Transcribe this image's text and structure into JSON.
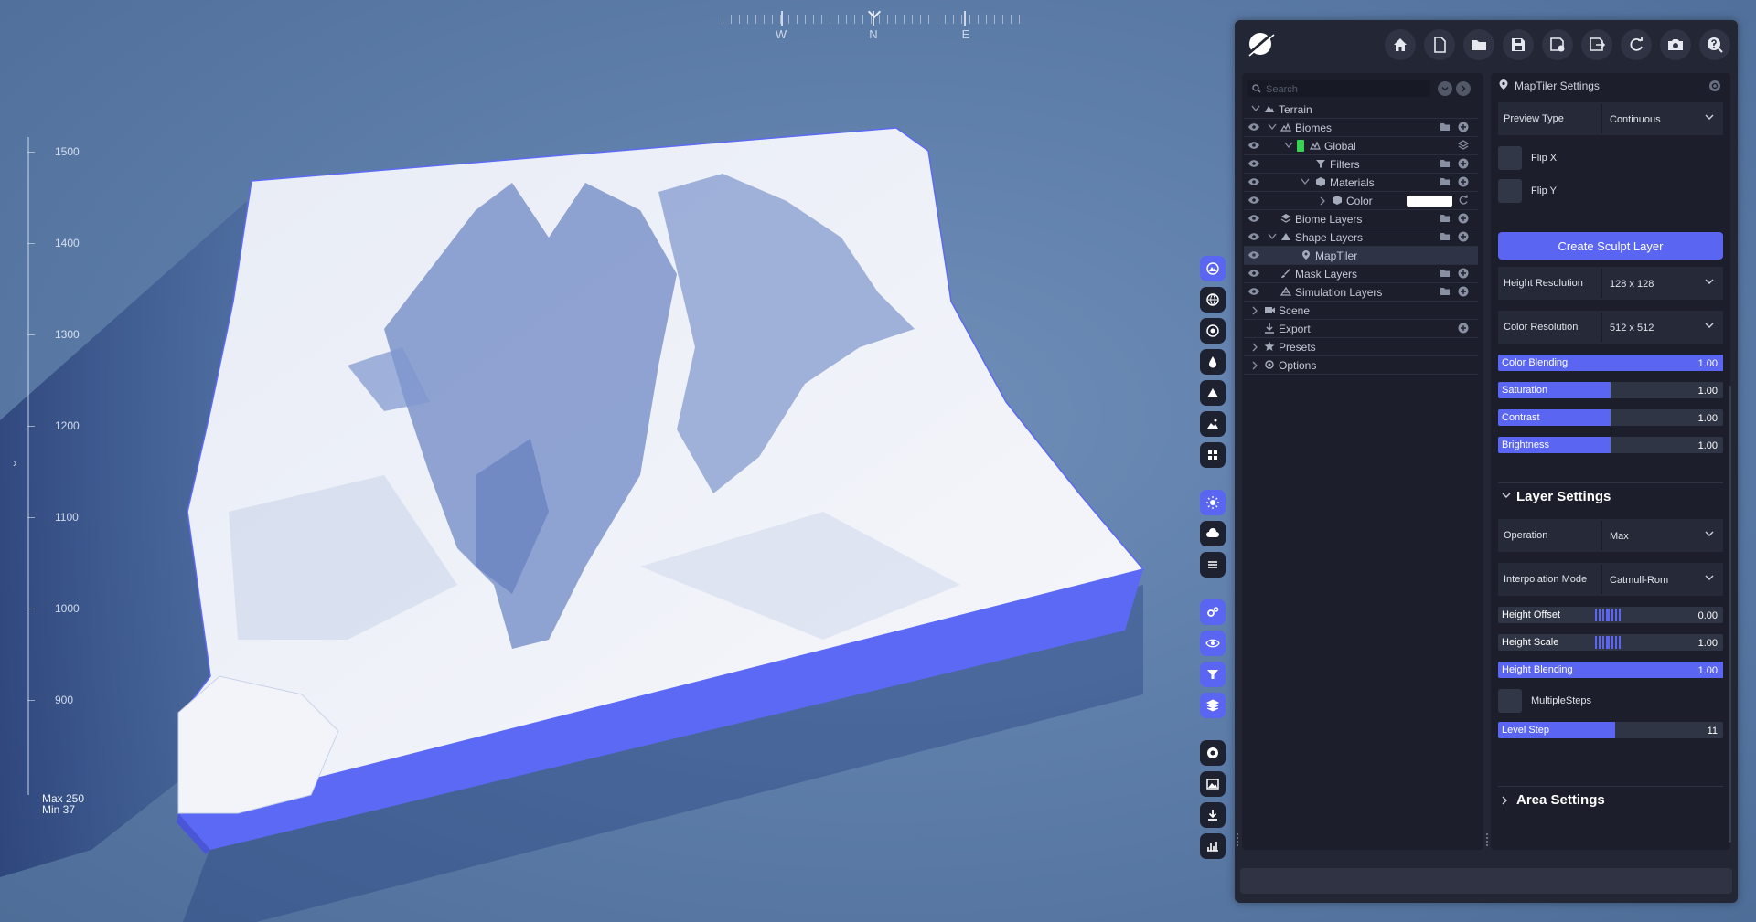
{
  "viewport": {
    "compass": [
      "W",
      "N",
      "E"
    ],
    "ruler_labels": [
      "1500",
      "1400",
      "1300",
      "1200",
      "1100",
      "1000",
      "900"
    ],
    "max_label": "Max 250",
    "min_label": "Min 37"
  },
  "toolbar": {
    "icons": [
      "home-icon",
      "new-file-icon",
      "open-folder-icon",
      "save-icon",
      "save-as-icon",
      "export-file-icon",
      "refresh-icon",
      "camera-icon",
      "help-icon"
    ]
  },
  "tree": {
    "search_placeholder": "Search",
    "rows": [
      {
        "label": "Terrain",
        "depth": 0
      },
      {
        "label": "Biomes",
        "depth": 1
      },
      {
        "label": "Global",
        "depth": 2
      },
      {
        "label": "Filters",
        "depth": 3
      },
      {
        "label": "Materials",
        "depth": 3
      },
      {
        "label": "Color",
        "depth": 4
      },
      {
        "label": "Biome Layers",
        "depth": 1
      },
      {
        "label": "Shape Layers",
        "depth": 1
      },
      {
        "label": "MapTiler",
        "depth": 2
      },
      {
        "label": "Mask Layers",
        "depth": 1
      },
      {
        "label": "Simulation Layers",
        "depth": 1
      },
      {
        "label": "Scene",
        "depth": 0
      },
      {
        "label": "Export",
        "depth": 0
      },
      {
        "label": "Presets",
        "depth": 0
      },
      {
        "label": "Options",
        "depth": 0
      }
    ]
  },
  "props": {
    "title": "MapTiler Settings",
    "preview_type": {
      "label": "Preview Type",
      "value": "Continuous"
    },
    "flip_x": "Flip X",
    "flip_y": "Flip Y",
    "create_button": "Create Sculpt Layer",
    "height_resolution": {
      "label": "Height Resolution",
      "value": "128 x 128"
    },
    "color_resolution": {
      "label": "Color Resolution",
      "value": "512 x 512"
    },
    "sliders1": [
      {
        "label": "Color Blending",
        "value": "1.00",
        "fill": 1.0
      },
      {
        "label": "Saturation",
        "value": "1.00",
        "fill": 0.5
      },
      {
        "label": "Contrast",
        "value": "1.00",
        "fill": 0.5
      },
      {
        "label": "Brightness",
        "value": "1.00",
        "fill": 0.5
      }
    ],
    "layer_settings": "Layer Settings",
    "operation": {
      "label": "Operation",
      "value": "Max"
    },
    "interpolation": {
      "label": "Interpolation Mode",
      "value": "Catmull-Rom"
    },
    "height_offset": {
      "label": "Height Offset",
      "value": "0.00"
    },
    "height_scale": {
      "label": "Height Scale",
      "value": "1.00"
    },
    "height_blending": {
      "label": "Height Blending",
      "value": "1.00",
      "fill": 1.0
    },
    "multiple_steps": "MultipleSteps",
    "level_step": {
      "label": "Level Step",
      "value": "11",
      "fill": 0.52
    },
    "area_settings": "Area Settings"
  },
  "colors": {
    "accent": "#5a66f2",
    "panel": "#232634",
    "pane": "#1c1f2b"
  }
}
